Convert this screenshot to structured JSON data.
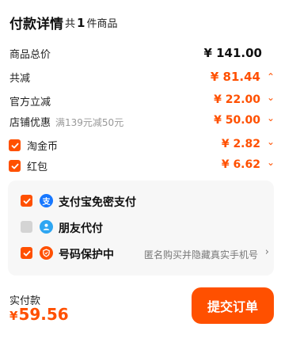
{
  "header": {
    "title": "付款详情",
    "count_prefix": "共",
    "count": "1",
    "count_suffix": "件商品"
  },
  "summary": {
    "total_label": "商品总价",
    "total_amount": "¥ 141.00",
    "discount_label": "共减",
    "discount_amount": "¥ 81.44",
    "discount_chevron": "⌃",
    "official_label": "官方立减",
    "official_amount": "¥ 22.00",
    "shop_label": "店铺优惠",
    "shop_sub": "满139元减50元",
    "shop_amount": "¥ 50.00",
    "coin_label": "淘金币",
    "coin_amount": "¥ 2.82",
    "hongbao_label": "红包",
    "hongbao_amount": "¥ 6.62",
    "chevron": "⌄"
  },
  "payment": {
    "alipay_label": "支付宝免密支付",
    "friend_label": "朋友代付",
    "privacy_label": "号码保护中",
    "privacy_note": "匿名购买并隐藏真实手机号",
    "privacy_chevron": "›"
  },
  "footer": {
    "paid_label": "实付款",
    "currency": "¥",
    "paid_amount": "59.56",
    "submit_label": "提交订单"
  },
  "colors": {
    "accent": "#ff5000",
    "alipay_blue": "#1677ff",
    "friend_blue": "#2ea6f2",
    "privacy_orange": "#ff5000"
  }
}
